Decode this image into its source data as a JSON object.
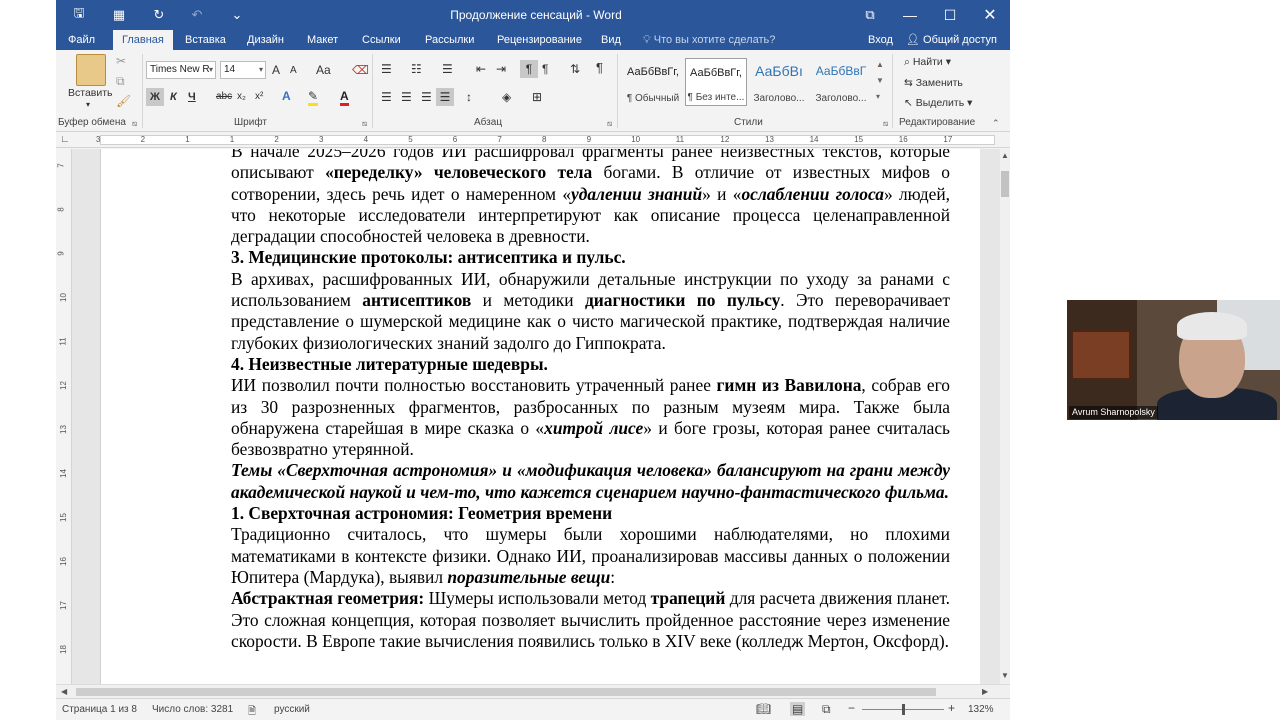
{
  "window": {
    "title": "Продолжение сенсаций - Word",
    "qat_save": "🖫",
    "qat_touch": "▦",
    "qat_redo": "↻",
    "qat_undo": "↶",
    "qat_more": "⌄",
    "restore_ribbon": "⧉",
    "minimize": "—",
    "maximize": "☐",
    "close": "✕"
  },
  "tabs": [
    "Файл",
    "Главная",
    "Вставка",
    "Дизайн",
    "Макет",
    "Ссылки",
    "Рассылки",
    "Рецензирование",
    "Вид"
  ],
  "tell_me": "Что вы хотите сделать?",
  "login": "Вход",
  "share": "Общий доступ",
  "ribbon": {
    "paste": "Вставить",
    "clipboard_label": "Буфер обмена",
    "font_name": "Times New R",
    "font_size": "14",
    "font_label": "Шрифт",
    "paragraph_label": "Абзац",
    "styles_label": "Стили",
    "editing_label": "Редактирование",
    "bold": "Ж",
    "italic": "К",
    "underline": "Ч",
    "strike": "abc",
    "subscript": "x₂",
    "superscript": "x²",
    "grow": "A",
    "shrink": "A",
    "case": "Aa",
    "styles": [
      {
        "preview": "АаБбВвГг,",
        "name": "¶ Обычный"
      },
      {
        "preview": "АаБбВвГг,",
        "name": "¶ Без инте..."
      },
      {
        "preview": "АаБбВı",
        "name": "Заголово..."
      },
      {
        "preview": "АаБбВвГ",
        "name": "Заголово..."
      }
    ],
    "find": "Найти",
    "replace": "Заменить",
    "select": "Выделить"
  },
  "ruler_ticks": [
    "3",
    "2",
    "1",
    "1",
    "2",
    "3",
    "4",
    "5",
    "6",
    "7",
    "8",
    "9",
    "10",
    "11",
    "12",
    "13",
    "14",
    "15",
    "16",
    "17"
  ],
  "vruler_ticks": [
    "7",
    "8",
    "9",
    "10",
    "11",
    "12",
    "13",
    "14",
    "15",
    "16",
    "17",
    "18"
  ],
  "doc": {
    "p1_a": "В начале 2025–2026 годов ИИ расшифровал фрагменты ранее неизвестных текстов, которые описывают ",
    "p1_b1": "«переделку» человеческого тела",
    "p1_c": " богами. В отличие от известных мифов о сотворении, здесь речь идет о намеренном «",
    "p1_i1": "удалении знаний",
    "p1_d": "» и «",
    "p1_i2": "ослаблении голоса",
    "p1_e": "» людей, что некоторые исследователи интерпретируют как описание процесса целенаправленной деградации способностей человека в древности.",
    "h3": "3. Медицинские протоколы: антисептика и пульс.",
    "p2_a": "В архивах, расшифрованных ИИ, обнаружили детальные инструкции по уходу за ранами с использованием ",
    "p2_b1": "антисептиков",
    "p2_c": " и методики ",
    "p2_b2": "диагностики по пульсу",
    "p2_d": ". Это переворачивает представление о шумерской медицине как о чисто магической практике, подтверждая наличие глубоких физиологических знаний задолго до Гиппократа.",
    "h4": "4. Неизвестные литературные шедевры.",
    "p3_a": "ИИ позволил почти полностью восстановить утраченный ранее ",
    "p3_b1": "гимн из Вавилона",
    "p3_c": ", собрав его из 30 разрозненных фрагментов, разбросанных по разным музеям мира. Также была обнаружена старейшая в мире сказка о «",
    "p3_i1": "хитрой лисе",
    "p3_d": "» и боге грозы, которая ранее считалась безвозвратно утерянной.",
    "p4": "Темы «Сверхточная астрономия» и «модификация человека» балансируют на грани между академической наукой и чем-то, что кажется сценарием научно-фантастического фильма.",
    "h5": "1. Сверхточная астрономия: Геометрия времени",
    "p5_a": "Традиционно считалось, что шумеры были хорошими наблюдателями, но плохими математиками в контексте физики. Однако ИИ, проанализировав массивы данных о положении Юпитера (Мардука), выявил ",
    "p5_i1": "поразительные вещи",
    "p5_b": ":",
    "p6_b1": "Абстрактная геометрия:",
    "p6_a": " Шумеры использовали метод ",
    "p6_b2": "трапеций",
    "p6_c": " для расчета движения планет. Это сложная концепция, которая позволяет вычислить пройденное расстояние через изменение скорости. В Европе такие вычисления появились только в XIV веке (колледж Мертон, Оксфорд)."
  },
  "status": {
    "page": "Страница 1 из 8",
    "words": "Число слов: 3281",
    "lang": "русский",
    "zoom": "132%"
  },
  "video": {
    "name": "Avrum Sharnopolsky"
  }
}
